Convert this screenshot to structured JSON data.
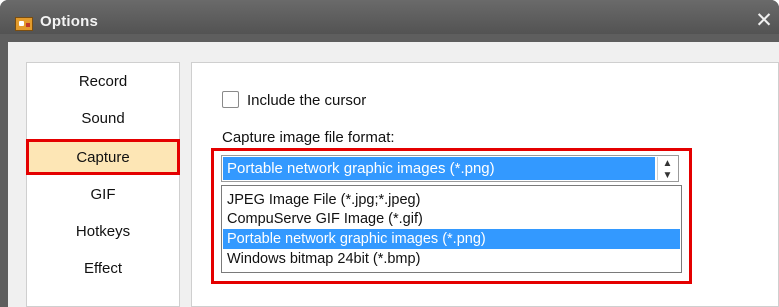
{
  "window": {
    "title": "Options",
    "close_glyph": "✕",
    "icon": "app-icon"
  },
  "nav": {
    "items": [
      {
        "label": "Record"
      },
      {
        "label": "Sound"
      },
      {
        "label": "Capture",
        "selected": true
      },
      {
        "label": "GIF"
      },
      {
        "label": "Hotkeys"
      },
      {
        "label": "Effect"
      }
    ]
  },
  "capture": {
    "include_cursor_label": "Include the cursor",
    "include_cursor_checked": false,
    "format_label": "Capture image file format:",
    "selected_format": "Portable network graphic images (*.png)",
    "options": [
      "JPEG Image File (*.jpg;*.jpeg)",
      "CompuServe GIF Image (*.gif)",
      "Portable network graphic images (*.png)",
      "Windows bitmap 24bit (*.bmp)"
    ],
    "highlighted_option_index": 2
  },
  "colors": {
    "highlight": "#3399ff",
    "annotation_red": "#e40000",
    "selected_nav_bg": "#fde6b5"
  }
}
